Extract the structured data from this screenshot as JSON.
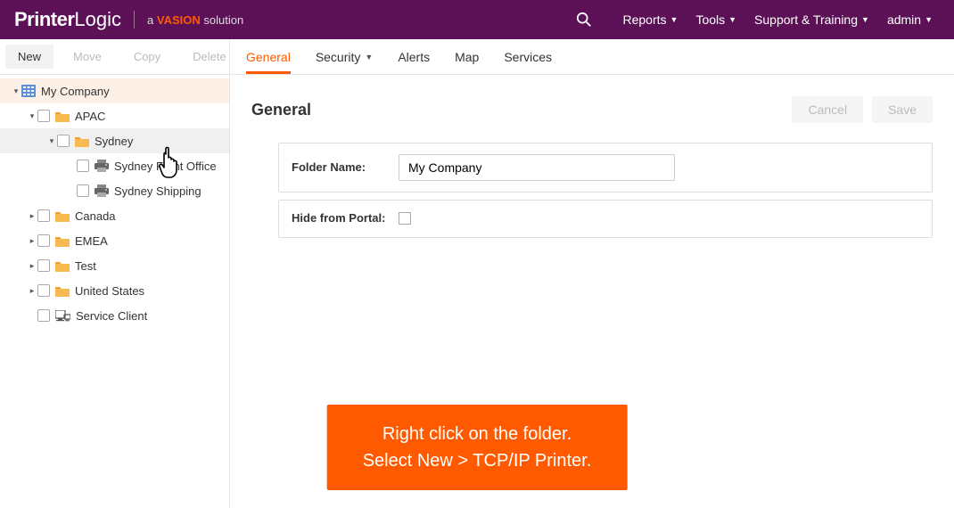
{
  "header": {
    "logo_p1": "Printer",
    "logo_p2": "Logic",
    "tag_prefix": "a ",
    "tag_brand": "VASION",
    "tag_suffix": " solution",
    "nav": {
      "reports": "Reports",
      "tools": "Tools",
      "support": "Support & Training",
      "admin": "admin"
    }
  },
  "toolbar": {
    "new": "New",
    "move": "Move",
    "copy": "Copy",
    "delete": "Delete"
  },
  "tabs": {
    "general": "General",
    "security": "Security",
    "alerts": "Alerts",
    "map": "Map",
    "services": "Services"
  },
  "tree": {
    "root": "My Company",
    "apac": "APAC",
    "sydney": "Sydney",
    "sydney_front": "Sydney Front Office",
    "sydney_shipping": "Sydney Shipping",
    "canada": "Canada",
    "emea": "EMEA",
    "test": "Test",
    "us": "United States",
    "service_client": "Service Client"
  },
  "panel": {
    "title": "General",
    "cancel": "Cancel",
    "save": "Save",
    "folder_name_label": "Folder Name:",
    "folder_name_value": "My Company",
    "hide_label": "Hide from Portal:"
  },
  "instruction": {
    "line1": "Right click on the folder.",
    "line2": "Select New > TCP/IP Printer."
  }
}
